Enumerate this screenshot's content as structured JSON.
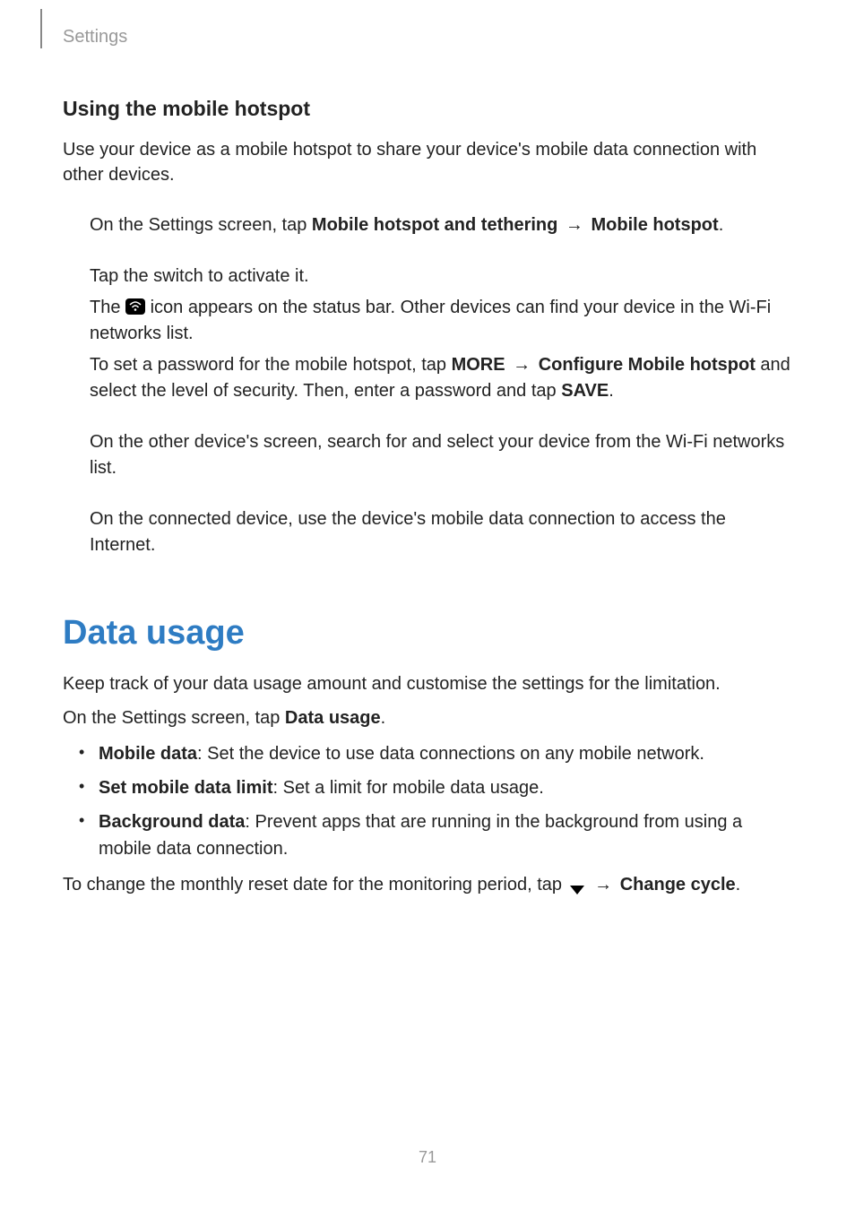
{
  "header": {
    "section": "Settings"
  },
  "hotspot": {
    "heading": "Using the mobile hotspot",
    "intro": "Use your device as a mobile hotspot to share your device's mobile data connection with other devices.",
    "step1_prefix": "On the Settings screen, tap ",
    "step1_bold1": "Mobile hotspot and tethering",
    "step1_arrow": " → ",
    "step1_bold2": "Mobile hotspot",
    "step1_suffix": ".",
    "step2a": "Tap the switch to activate it.",
    "step2b_prefix": "The ",
    "step2b_suffix": " icon appears on the status bar. Other devices can find your device in the Wi-Fi networks list.",
    "step2c_prefix": "To set a password for the mobile hotspot, tap ",
    "step2c_bold1": "MORE",
    "step2c_arrow": " → ",
    "step2c_bold2": "Configure Mobile hotspot",
    "step2c_mid": " and select the level of security. Then, enter a password and tap ",
    "step2c_bold3": "SAVE",
    "step2c_suffix": ".",
    "step3": "On the other device's screen, search for and select your device from the Wi-Fi networks list.",
    "step4": "On the connected device, use the device's mobile data connection to access the Internet."
  },
  "datausage": {
    "heading": "Data usage",
    "intro": "Keep track of your data usage amount and customise the settings for the limitation.",
    "nav_prefix": "On the Settings screen, tap ",
    "nav_bold": "Data usage",
    "nav_suffix": ".",
    "bullets": [
      {
        "bold": "Mobile data",
        "text": ": Set the device to use data connections on any mobile network."
      },
      {
        "bold": "Set mobile data limit",
        "text": ": Set a limit for mobile data usage."
      },
      {
        "bold": "Background data",
        "text": ": Prevent apps that are running in the background from using a mobile data connection."
      }
    ],
    "cycle_prefix": "To change the monthly reset date for the monitoring period, tap ",
    "cycle_arrow": " → ",
    "cycle_bold": "Change cycle",
    "cycle_suffix": "."
  },
  "pageNumber": "71"
}
